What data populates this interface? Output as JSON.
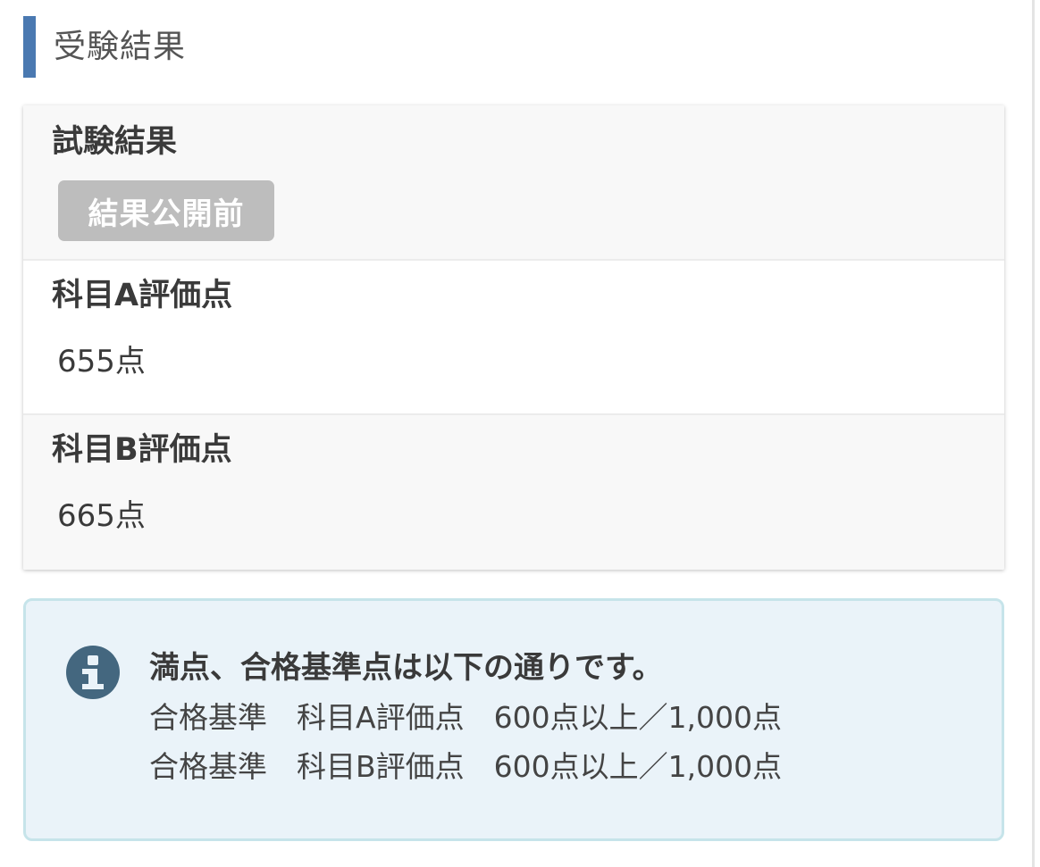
{
  "section": {
    "title": "受験結果"
  },
  "results": {
    "status_label": "試験結果",
    "status_badge": "結果公開前",
    "subject_a": {
      "label": "科目A評価点",
      "value": "655点"
    },
    "subject_b": {
      "label": "科目B評価点",
      "value": "665点"
    }
  },
  "info": {
    "icon": "info-icon",
    "title": "満点、合格基準点は以下の通りです。",
    "lines": [
      "合格基準　科目A評価点　600点以上／1,000点",
      "合格基準　科目B評価点　600点以上／1,000点"
    ]
  },
  "colors": {
    "heading_accent": "#4a79b1",
    "badge_bg": "#bdbdbd",
    "info_bg": "#eaf3f9",
    "info_border": "#c6e4ea",
    "info_icon": "#44677f"
  }
}
